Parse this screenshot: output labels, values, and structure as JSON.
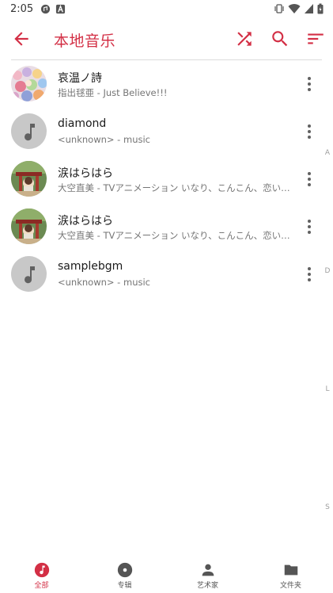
{
  "status_bar": {
    "time": "2:05",
    "icons": [
      "notification-icon",
      "a-badge-icon",
      "vibrate-icon",
      "wifi-icon",
      "signal-icon",
      "battery-icon"
    ]
  },
  "toolbar": {
    "title": "本地音乐",
    "back_icon": "arrow-back-icon",
    "shuffle_icon": "shuffle-icon",
    "search_icon": "search-icon",
    "sort_icon": "sort-icon"
  },
  "songs": [
    {
      "title": "哀温ノ詩",
      "subtitle": "指出毬亜 - Just Believe!!!",
      "cover": "artwork-crowd"
    },
    {
      "title": "diamond",
      "subtitle": "<unknown> - music",
      "cover": "music-note-placeholder"
    },
    {
      "title": "涙はらはら",
      "subtitle": "大空直美 - TVアニメーション いなり、こんこん、恋いろは。",
      "cover": "artwork-shrine"
    },
    {
      "title": "涙はらはら",
      "subtitle": "大空直美 - TVアニメーション いなり、こんこん、恋いろは。",
      "cover": "artwork-shrine"
    },
    {
      "title": "samplebgm",
      "subtitle": "<unknown> - music",
      "cover": "music-note-placeholder"
    }
  ],
  "index_letters": [
    "A",
    "D",
    "L",
    "S"
  ],
  "bottom_nav": [
    {
      "label": "全部",
      "icon": "music-note-icon",
      "active": true
    },
    {
      "label": "专辑",
      "icon": "album-icon",
      "active": false
    },
    {
      "label": "艺术家",
      "icon": "person-icon",
      "active": false
    },
    {
      "label": "文件夹",
      "icon": "folder-icon",
      "active": false
    }
  ],
  "colors": {
    "accent": "#d32f45",
    "text": "#1a1a1a",
    "secondary": "#757575",
    "placeholder_bg": "#c8c8c8"
  }
}
